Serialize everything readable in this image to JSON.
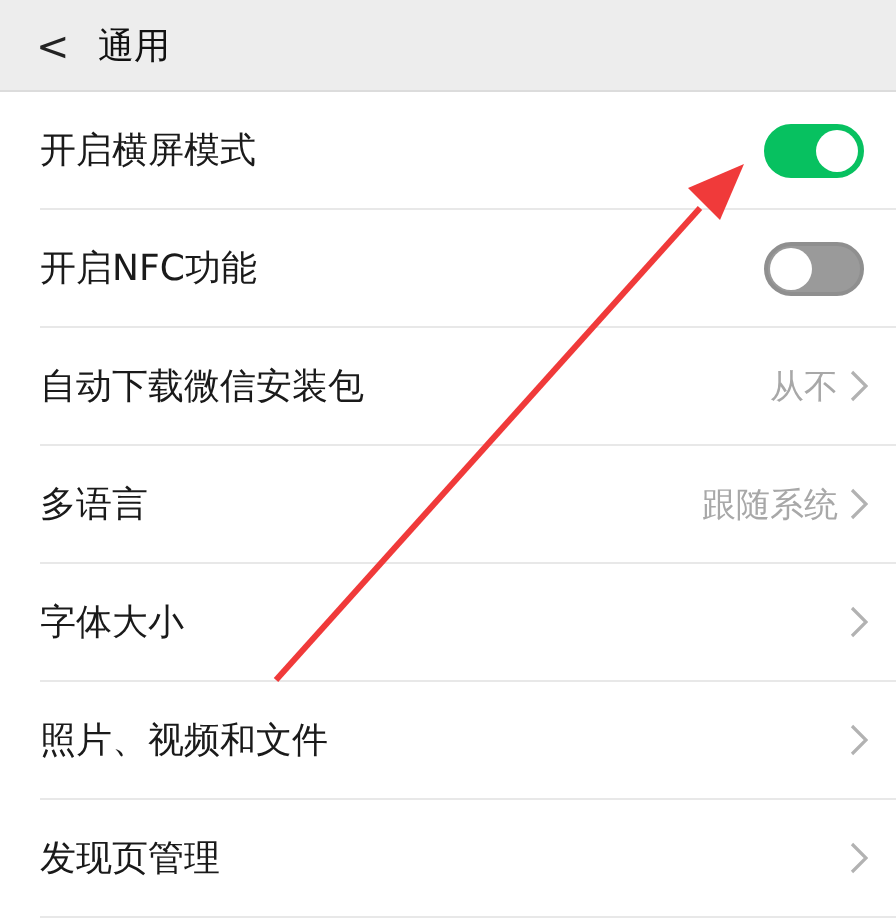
{
  "header": {
    "back": "<",
    "title": "通用"
  },
  "rows": [
    {
      "kind": "toggle",
      "label": "开启横屏模式",
      "on": true
    },
    {
      "kind": "toggle",
      "label": "开启NFC功能",
      "on": false
    },
    {
      "kind": "link",
      "label": "自动下载微信安装包",
      "value": "从不"
    },
    {
      "kind": "link",
      "label": "多语言",
      "value": "跟随系统"
    },
    {
      "kind": "link",
      "label": "字体大小"
    },
    {
      "kind": "link",
      "label": "照片、视频和文件"
    },
    {
      "kind": "link",
      "label": "发现页管理"
    }
  ]
}
